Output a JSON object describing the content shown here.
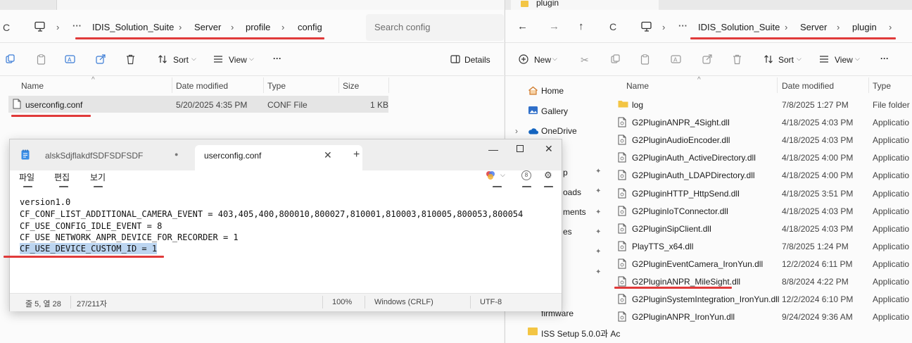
{
  "left_explorer": {
    "breadcrumb": [
      "IDIS_Solution_Suite",
      "Server",
      "profile",
      "config"
    ],
    "search_placeholder": "Search config",
    "toolbar": {
      "sort": "Sort",
      "view": "View",
      "more": "···",
      "details": "Details",
      "ellipsis": "···"
    },
    "columns": [
      "Name",
      "Date modified",
      "Type",
      "Size"
    ],
    "files": [
      {
        "name": "userconfig.conf",
        "date": "5/20/2025 4:35 PM",
        "type": "CONF File",
        "size": "1 KB"
      }
    ]
  },
  "notepad": {
    "tabs": [
      {
        "label": "alskSdjflakdfSDFSDFSDF",
        "active": false
      },
      {
        "label": "userconfig.conf",
        "active": true
      }
    ],
    "tab_dot": "●",
    "new_tab": "+",
    "menu": [
      {
        "label": "파일",
        "keytip": "F"
      },
      {
        "label": "편집",
        "keytip": "E"
      },
      {
        "label": "보기",
        "keytip": "V"
      }
    ],
    "right_keytips": [
      "R",
      "U",
      "S"
    ],
    "lines": [
      "version1.0",
      "CF_CONF_LIST_ADDITIONAL_CAMERA_EVENT = 403,405,400,800010,800027,810001,810003,810005,800053,800054",
      "CF_USE_CONFIG_IDLE_EVENT = 8",
      "CF_USE_NETWORK_ANPR_DEVICE_FOR_RECORDER = 1",
      "CF_USE_DEVICE_CUSTOM_ID = 1"
    ],
    "status": {
      "position": "줄 5, 열 28",
      "chars": "27/211자",
      "zoom": "100%",
      "eol": "Windows (CRLF)",
      "encoding": "UTF-8"
    }
  },
  "right_explorer": {
    "title_tab": "plugin",
    "breadcrumb": [
      "IDIS_Solution_Suite",
      "Server",
      "plugin"
    ],
    "toolbar": {
      "new": "New",
      "sort": "Sort",
      "view": "View",
      "more": "···",
      "ellipsis": "···"
    },
    "nav": [
      {
        "label": "Home"
      },
      {
        "label": "Gallery"
      },
      {
        "label": "OneDrive"
      },
      {
        "label": "p"
      },
      {
        "label": "oads"
      },
      {
        "label": "ments"
      },
      {
        "label": "es"
      },
      {
        "label": "firmware"
      },
      {
        "label": "ISS Setup 5.0.0과 Ac"
      }
    ],
    "columns": [
      "Name",
      "Date modified",
      "Type"
    ],
    "files": [
      {
        "name": "log",
        "date": "7/8/2025 1:27 PM",
        "type": "File folder",
        "kind": "folder"
      },
      {
        "name": "G2PluginANPR_4Sight.dll",
        "date": "4/18/2025 4:03 PM",
        "type": "Applicatio",
        "kind": "dll"
      },
      {
        "name": "G2PluginAudioEncoder.dll",
        "date": "4/18/2025 4:03 PM",
        "type": "Applicatio",
        "kind": "dll"
      },
      {
        "name": "G2PluginAuth_ActiveDirectory.dll",
        "date": "4/18/2025 4:00 PM",
        "type": "Applicatio",
        "kind": "dll"
      },
      {
        "name": "G2PluginAuth_LDAPDirectory.dll",
        "date": "4/18/2025 4:00 PM",
        "type": "Applicatio",
        "kind": "dll"
      },
      {
        "name": "G2PluginHTTP_HttpSend.dll",
        "date": "4/18/2025 3:51 PM",
        "type": "Applicatio",
        "kind": "dll"
      },
      {
        "name": "G2PluginIoTConnector.dll",
        "date": "4/18/2025 4:03 PM",
        "type": "Applicatio",
        "kind": "dll"
      },
      {
        "name": "G2PluginSipClient.dll",
        "date": "4/18/2025 4:03 PM",
        "type": "Applicatio",
        "kind": "dll"
      },
      {
        "name": "PlayTTS_x64.dll",
        "date": "7/8/2025 1:24 PM",
        "type": "Applicatio",
        "kind": "dll"
      },
      {
        "name": "G2PluginEventCamera_IronYun.dll",
        "date": "12/2/2024 6:11 PM",
        "type": "Applicatio",
        "kind": "dll"
      },
      {
        "name": "G2PluginANPR_MileSight.dll",
        "date": "8/8/2024 4:22 PM",
        "type": "Applicatio",
        "kind": "dll"
      },
      {
        "name": "G2PluginSystemIntegration_IronYun.dll",
        "date": "12/2/2024 6:10 PM",
        "type": "Applicatio",
        "kind": "dll"
      },
      {
        "name": "G2PluginANPR_IronYun.dll",
        "date": "9/24/2024 9:36 AM",
        "type": "Applicatio",
        "kind": "dll"
      }
    ]
  },
  "colors": {
    "annotation_red": "#e03a3a",
    "selection_blue": "#bcd5f0",
    "folder_yellow": "#f3c544"
  }
}
